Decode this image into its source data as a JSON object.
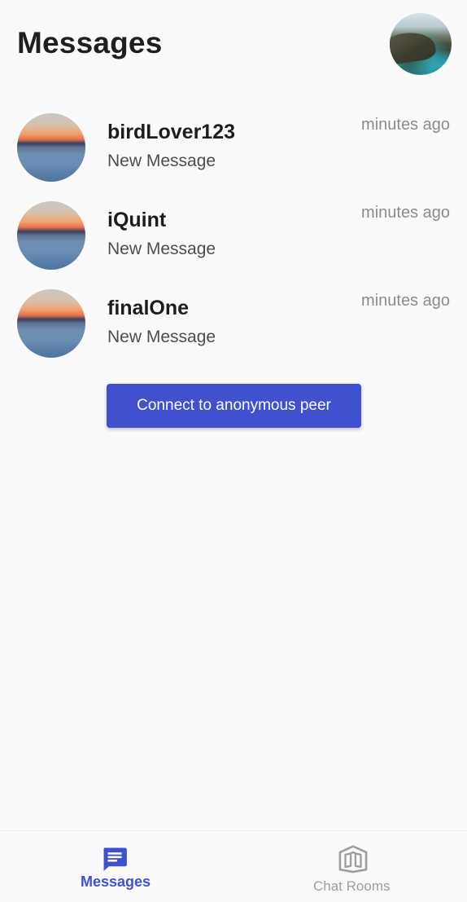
{
  "header": {
    "title": "Messages",
    "profile_avatar": "profile-photo-coastline"
  },
  "conversations": [
    {
      "name": "birdLover123",
      "preview": "New Message",
      "time": "minutes ago",
      "avatar": "sunset-sea-avatar"
    },
    {
      "name": "iQuint",
      "preview": "New Message",
      "time": "minutes ago",
      "avatar": "sunset-sea-avatar"
    },
    {
      "name": "finalOne",
      "preview": "New Message",
      "time": "minutes ago",
      "avatar": "sunset-sea-avatar"
    }
  ],
  "connect_button": {
    "label": "Connect to anonymous peer"
  },
  "bottom_nav": {
    "items": [
      {
        "label": "Messages",
        "icon": "message-icon",
        "active": true
      },
      {
        "label": "Chat Rooms",
        "icon": "chat-rooms-icon",
        "active": false
      }
    ]
  },
  "colors": {
    "accent": "#3f51cf",
    "inactive": "#9e9e9e",
    "background": "#fafafa"
  }
}
